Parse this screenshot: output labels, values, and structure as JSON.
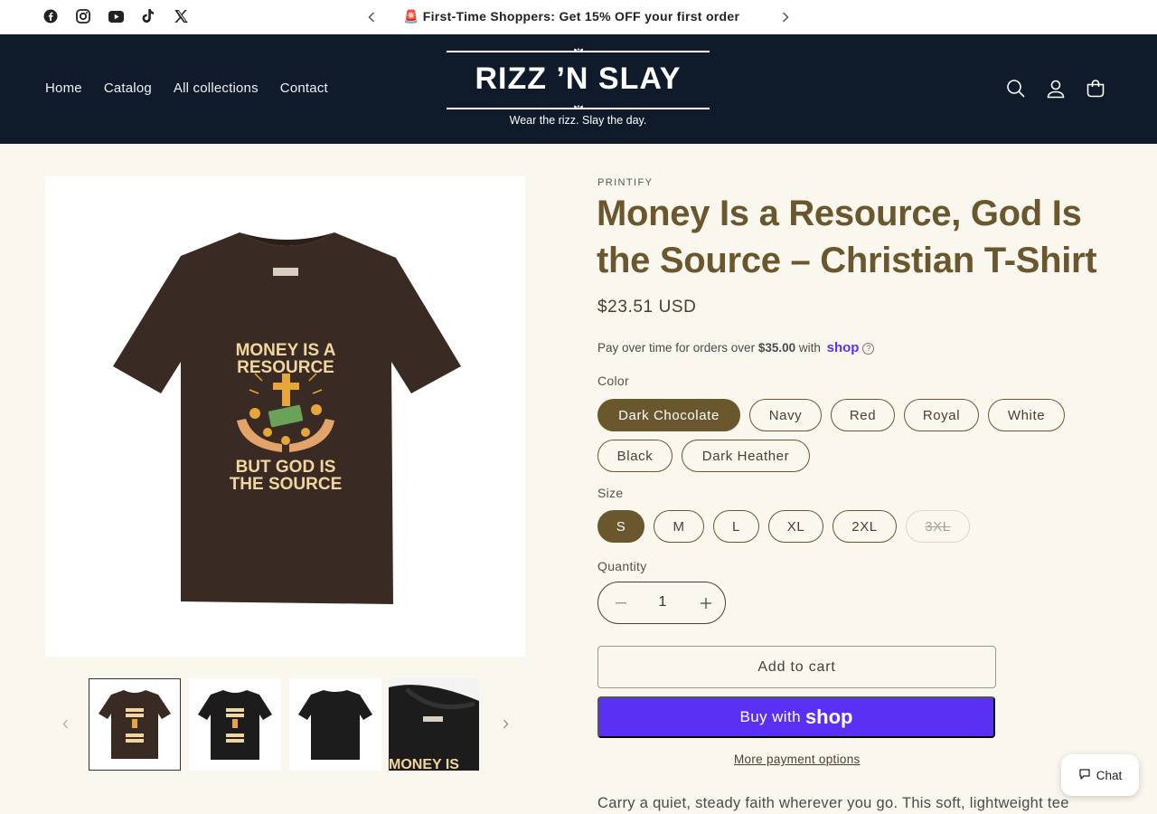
{
  "announcement": {
    "text": "First-Time Shoppers: Get 15% OFF your first order",
    "siren": "🚨"
  },
  "social": [
    "facebook-icon",
    "instagram-icon",
    "youtube-icon",
    "tiktok-icon",
    "x-icon"
  ],
  "nav": {
    "items": [
      {
        "label": "Home"
      },
      {
        "label": "Catalog"
      },
      {
        "label": "All collections"
      },
      {
        "label": "Contact"
      }
    ]
  },
  "logo": {
    "title": "RIZZ ’N SLAY",
    "tagline": "Wear the rizz. Slay the day."
  },
  "gallery": {
    "shirt_text_top": "MONEY IS A RESOURCE",
    "shirt_text_bottom": "BUT GOD IS THE SOURCE",
    "thumb4_text": "MONEY IS"
  },
  "product": {
    "vendor": "PRINTIFY",
    "title": "Money Is a Resource, God Is the Source – Christian T-Shirt",
    "price": "$23.51 USD",
    "installments_prefix": "Pay over time for orders over ",
    "installments_amount": "$35.00",
    "installments_with": " with ",
    "installments_brand": "shop",
    "color_label": "Color",
    "colors": [
      {
        "label": "Dark Chocolate",
        "selected": true
      },
      {
        "label": "Navy"
      },
      {
        "label": "Red"
      },
      {
        "label": "Royal"
      },
      {
        "label": "White"
      },
      {
        "label": "Black"
      },
      {
        "label": "Dark Heather"
      }
    ],
    "size_label": "Size",
    "sizes": [
      {
        "label": "S",
        "selected": true
      },
      {
        "label": "M"
      },
      {
        "label": "L"
      },
      {
        "label": "XL"
      },
      {
        "label": "2XL"
      },
      {
        "label": "3XL",
        "disabled": true
      }
    ],
    "quantity_label": "Quantity",
    "quantity": "1",
    "add_to_cart": "Add to cart",
    "buy_with": "Buy with",
    "buy_brand": "shop",
    "more_payment": "More payment options",
    "description": "Carry a quiet, steady faith wherever you go. This soft, lightweight tee"
  },
  "chat": {
    "label": "Chat"
  },
  "colors": {
    "header_bg": "#0f1b2a",
    "accent": "#6b572d",
    "shop_purple": "#5a31f4",
    "page_bg": "#faf7ef"
  }
}
